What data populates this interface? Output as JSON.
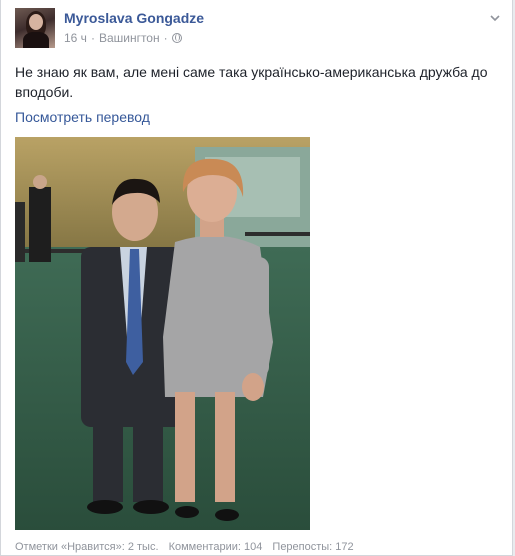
{
  "post": {
    "author": "Myroslava Gongadze",
    "time": "16 ч",
    "separator": "·",
    "location": "Вашингтон",
    "privacy_icon": "globe-icon",
    "options_icon": "chevron-down-icon",
    "text": "Не знаю як вам, але мені саме така українсько-американська дружба до вподоби.",
    "translate_link": "Посмотреть перевод",
    "photo_icon": "photo-of-two-people"
  },
  "stats": {
    "likes": "Отметки «Нравится»: 2 тыс.",
    "comments": "Комментарии: 104",
    "shares": "Перепосты: 172"
  },
  "colors": {
    "link": "#3b5998",
    "meta": "#90949c",
    "text": "#1d2129"
  }
}
